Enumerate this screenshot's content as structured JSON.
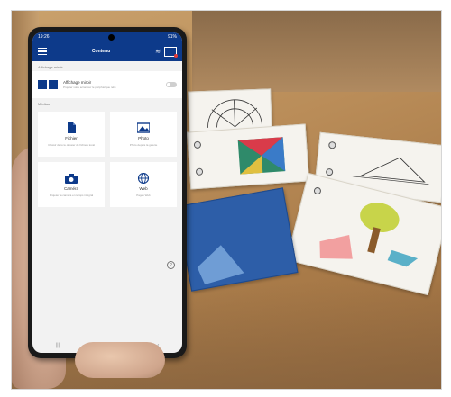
{
  "status_bar": {
    "time": "19:26",
    "battery": "91%"
  },
  "app_bar": {
    "title": "Contenu"
  },
  "mirror_section": {
    "label": "Affichage miroir",
    "item_title": "Affichage miroir",
    "item_subtitle": "Projeter votre écran sur le périphérique relié"
  },
  "media_section": {
    "label": "Médias",
    "tiles": [
      {
        "label": "Fichier",
        "subtitle": "Choisir dans le dossier de fichiers local",
        "icon": "file-icon"
      },
      {
        "label": "Photo",
        "subtitle": "Photo depuis la galerie",
        "icon": "image-icon"
      },
      {
        "label": "Caméra",
        "subtitle": "Projeter la caméra en temps intégral",
        "icon": "camera-icon"
      },
      {
        "label": "Web",
        "subtitle": "Pages Web",
        "icon": "globe-icon"
      }
    ]
  },
  "nav_bar": {
    "recent": "|||",
    "home": "▢",
    "back": "‹"
  },
  "help": "?"
}
